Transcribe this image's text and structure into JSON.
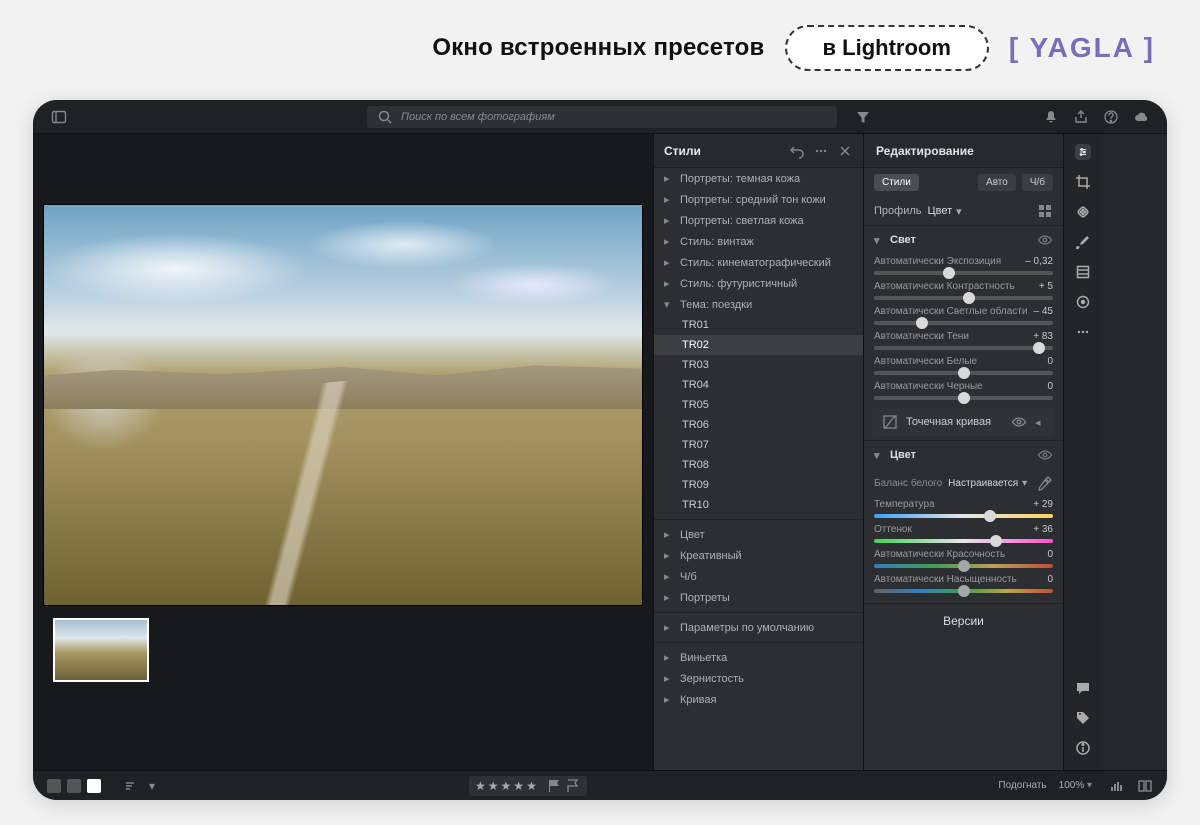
{
  "header": {
    "headline": "Окно встроенных пресетов",
    "pill": "в Lightroom",
    "logo": "YAGLA"
  },
  "topbar": {
    "search_placeholder": "Поиск по всем фотографиям"
  },
  "presets": {
    "title": "Стили",
    "groups_top": [
      "Портреты: темная кожа",
      "Портреты: средний тон кожи",
      "Портреты: светлая кожа",
      "Стиль: винтаж",
      "Стиль: кинематографический",
      "Стиль: футуристичный"
    ],
    "expanded_group": "Тема: поездки",
    "items": [
      "TR01",
      "TR02",
      "TR03",
      "TR04",
      "TR05",
      "TR06",
      "TR07",
      "TR08",
      "TR09",
      "TR10"
    ],
    "selected_item": "TR02",
    "groups_mid": [
      "Цвет",
      "Креативный",
      "Ч/б",
      "Портреты"
    ],
    "defaults": "Параметры по умолчанию",
    "groups_bottom": [
      "Виньетка",
      "Зернистость",
      "Кривая"
    ]
  },
  "edit": {
    "title": "Редактирование",
    "chips": {
      "styles": "Стили",
      "auto": "Авто",
      "bw": "Ч/б"
    },
    "profile_label": "Профиль",
    "profile_value": "Цвет",
    "light": {
      "title": "Свет",
      "sliders": [
        {
          "prefix": "Автоматически",
          "name": "Экспозиция",
          "value": "– 0,32",
          "pos": 42
        },
        {
          "prefix": "Автоматически",
          "name": "Контрастность",
          "value": "+ 5",
          "pos": 53
        },
        {
          "prefix": "Автоматически",
          "name": "Светлые области",
          "value": "– 45",
          "pos": 27
        },
        {
          "prefix": "Автоматически",
          "name": "Тени",
          "value": "+ 83",
          "pos": 92
        },
        {
          "prefix": "Автоматически",
          "name": "Белые",
          "value": "0",
          "pos": 50
        },
        {
          "prefix": "Автоматически",
          "name": "Черные",
          "value": "0",
          "pos": 50
        }
      ],
      "curve": "Точечная кривая"
    },
    "color": {
      "title": "Цвет",
      "wb_label": "Баланс белого",
      "wb_value": "Настраивается",
      "sliders": [
        {
          "name": "Температура",
          "value": "+ 29",
          "pos": 65,
          "grad": "grad-temp"
        },
        {
          "name": "Оттенок",
          "value": "+ 36",
          "pos": 68,
          "grad": "grad-tint"
        },
        {
          "prefix": "Автоматически",
          "name": "Красочность",
          "value": "0",
          "pos": 50,
          "grad": "grad-vib"
        },
        {
          "prefix": "Автоматически",
          "name": "Насыщенность",
          "value": "0",
          "pos": 50,
          "grad": "grad-sat"
        }
      ]
    },
    "versions": "Версии"
  },
  "bottombar": {
    "fit": "Подогнать",
    "zoom": "100%"
  }
}
